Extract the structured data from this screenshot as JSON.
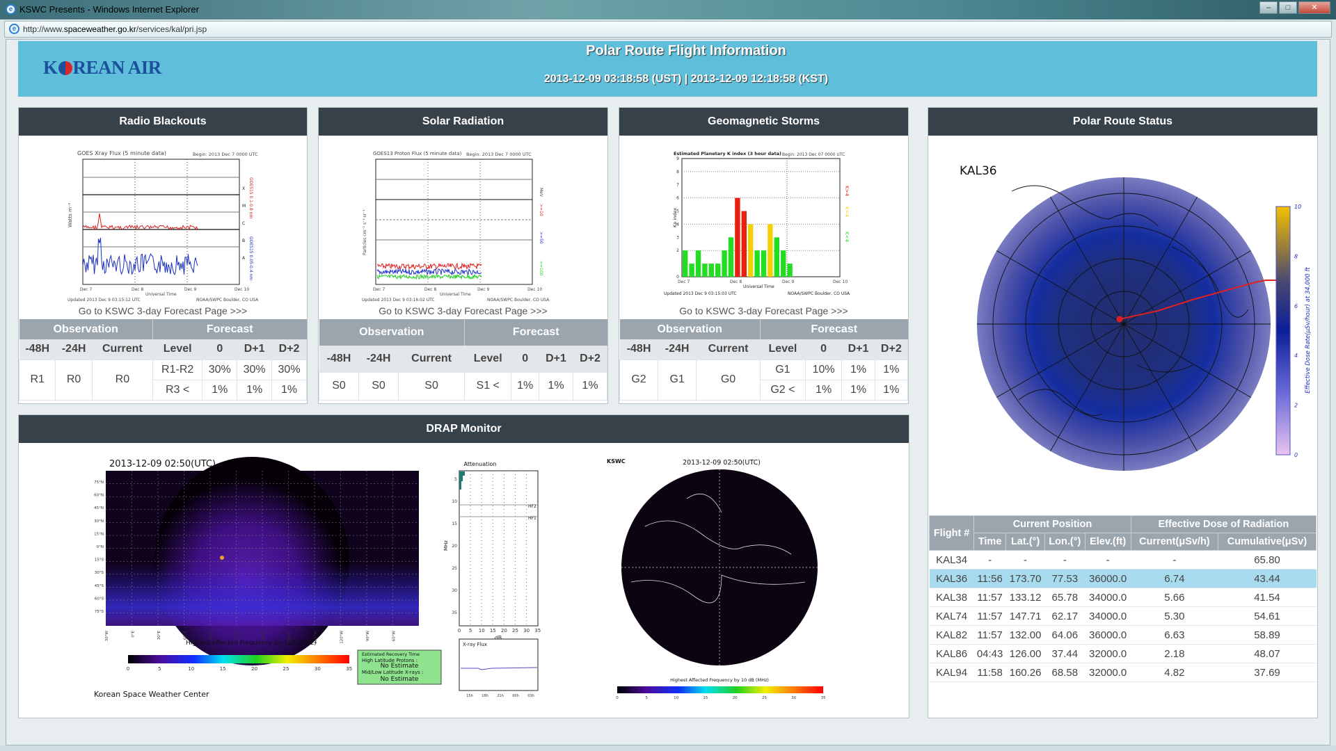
{
  "browser": {
    "title": "KSWC Presents - Windows Internet Explorer",
    "url_prefix": "http://www.",
    "url_domain": "spaceweather.go.kr",
    "url_path": "/services/kal/pri.jsp"
  },
  "header": {
    "logo": "KOREAN AIR",
    "title": "Polar Route Flight Information",
    "time": "2013-12-09 03:18:58 (UST) | 2013-12-09 12:18:58 (KST)"
  },
  "table_headers": {
    "observation": "Observation",
    "forecast": "Forecast",
    "cols": [
      "-48H",
      "-24H",
      "Current",
      "Level",
      "0",
      "D+1",
      "D+2"
    ]
  },
  "radio": {
    "title": "Radio Blackouts",
    "link": "Go to KSWC 3-day Forecast Page >>>",
    "chart": {
      "title": "GOES Xray Flux (5 minute data)",
      "begin": "Begin: 2013 Dec 7 0000 UTC",
      "updated": "Updated 2013 Dec 9 03:15:12 UTC",
      "source": "NOAA/SWPC Boulder, CO USA",
      "xlabel": "Universal Time",
      "ylabel": "Watts m⁻²",
      "x_ticks": [
        "Dec 7",
        "Dec 8",
        "Dec 9",
        "Dec 10"
      ],
      "classes": [
        "X",
        "M",
        "C",
        "B",
        "A"
      ],
      "series": [
        {
          "name": "GOES15 0.1-0.8 nm",
          "color": "#d42020"
        },
        {
          "name": "GOES15 0.05-0.4 nm",
          "color": "#1a2fc0"
        }
      ]
    },
    "obs": [
      "R1",
      "R0",
      "R0"
    ],
    "forecast": [
      {
        "level": "R1-R2",
        "values": [
          "30%",
          "30%",
          "30%"
        ]
      },
      {
        "level": "R3 <",
        "values": [
          "1%",
          "1%",
          "1%"
        ]
      }
    ]
  },
  "solar": {
    "title": "Solar Radiation",
    "link": "Go to KSWC 3-day Forecast Page >>>",
    "chart": {
      "title": "GOES13 Proton Flux (5 minute data)",
      "begin": "Begin: 2013 Dec 7 0000 UTC",
      "updated": "Updated 2013 Dec 9 03:16:02 UTC",
      "source": "NOAA/SWPC Boulder, CO USA",
      "xlabel": "Universal Time",
      "ylabel": "Particles cm⁻² s⁻¹ sr⁻¹",
      "x_ticks": [
        "Dec 7",
        "Dec 8",
        "Dec 9",
        "Dec 10"
      ],
      "unit": "MeV",
      "series": [
        {
          "name": ">=10",
          "color": "#e02020"
        },
        {
          "name": ">=50",
          "color": "#2030d0"
        },
        {
          "name": ">=100",
          "color": "#20d020"
        }
      ]
    },
    "obs": [
      "S0",
      "S0",
      "S0"
    ],
    "forecast": [
      {
        "level": "S1 <",
        "values": [
          "1%",
          "1%",
          "1%"
        ]
      }
    ]
  },
  "geo": {
    "title": "Geomagnetic Storms",
    "link": "Go to KSWC 3-day Forecast Page >>>",
    "chart": {
      "title": "Estimated Planetary K index (3 hour data)",
      "begin": "Begin: 2013 Dec 07 0000 UTC",
      "updated": "Updated 2013 Dec 9 03:15:03 UTC",
      "source": "NOAA/SWPC Boulder, CO USA",
      "xlabel": "Universal Time",
      "ylabel": "Kp index",
      "x_ticks": [
        "Dec 7",
        "Dec 8",
        "Dec 9",
        "Dec 10"
      ],
      "y_ticks": [
        "0",
        "",
        "2",
        "3",
        "4",
        "5",
        "6",
        "7",
        "8",
        "9"
      ],
      "legend": [
        "K>4",
        "K=4",
        "K<4"
      ],
      "kp": [
        2,
        1,
        2,
        1,
        1,
        1,
        2,
        3,
        6,
        5,
        4,
        2,
        2,
        4,
        3,
        2,
        1
      ],
      "colors": {
        "low": "#22dd22",
        "mid": "#f5d000",
        "high": "#e82010"
      }
    },
    "obs": [
      "G2",
      "G1",
      "G0"
    ],
    "forecast": [
      {
        "level": "G1",
        "values": [
          "10%",
          "1%",
          "1%"
        ]
      },
      {
        "level": "G2 <",
        "values": [
          "1%",
          "1%",
          "1%"
        ]
      }
    ]
  },
  "drap": {
    "title": "DRAP Monitor",
    "timestamp": "2013-12-09 02:50(UTC)",
    "lat_ticks": [
      "75°N",
      "60°N",
      "45°N",
      "30°N",
      "15°N",
      "0°N",
      "15°S",
      "30°S",
      "45°S",
      "60°S",
      "75°S"
    ],
    "lon_ticks": [
      "30°W",
      "0°E",
      "30°E",
      "60°E",
      "90°E",
      "120°E",
      "150°E",
      "180°E",
      "150°W",
      "120°W",
      "90°W",
      "60°W"
    ],
    "colorbar_label": "Highest Affected Frequency by 1dB (MHz)",
    "colorbar_ticks": [
      "0",
      "5",
      "10",
      "15",
      "20",
      "25",
      "30",
      "35"
    ],
    "attenuation": {
      "title": "Attenuation",
      "ylabel": "MHz",
      "xlabel": "dB",
      "y_ticks": [
        "5",
        "10",
        "15",
        "20",
        "25",
        "30",
        "35"
      ],
      "x_ticks": [
        "0",
        "5",
        "10",
        "15",
        "20",
        "25",
        "30",
        "35"
      ],
      "hf": [
        "HF2",
        "HF1"
      ]
    },
    "xray": {
      "title": "X-ray Flux",
      "x_ticks": [
        "15h",
        "18h",
        "21h",
        "00h",
        "03h"
      ]
    },
    "recovery": {
      "title": "Estimated Recovery Time",
      "high_label": "High Latitude Protons :",
      "high_value": "No Estimate",
      "low_label": "Mid/Low Latitude X-rays :",
      "low_value": "No Estimate"
    },
    "credit": "Korean Space Weather Center",
    "polar": {
      "label": "KSWC",
      "timestamp": "2013-12-09 02:50(UTC)",
      "colorbar_label": "Highest Affected Frequency by 10 dB (MHz)"
    }
  },
  "polar_route": {
    "title": "Polar Route Status",
    "flight_label": "KAL36",
    "colorbar_label": "Effective Dose Rate(μSv/hour) at 34,000 ft",
    "colorbar_ticks": [
      "0",
      "2",
      "4",
      "6",
      "8",
      "10"
    ],
    "table": {
      "flight_header": "Flight #",
      "group1": "Current Position",
      "group2": "Effective Dose of Radiation",
      "cols": [
        "Time",
        "Lat.(°)",
        "Lon.(°)",
        "Elev.(ft)",
        "Current(μSv/h)",
        "Cumulative(μSv)"
      ],
      "rows": [
        [
          "KAL34",
          "-",
          "-",
          "-",
          "-",
          "-",
          "65.80"
        ],
        [
          "KAL36",
          "11:56",
          "173.70",
          "77.53",
          "36000.0",
          "6.74",
          "43.44"
        ],
        [
          "KAL38",
          "11:57",
          "133.12",
          "65.78",
          "34000.0",
          "5.66",
          "41.54"
        ],
        [
          "KAL74",
          "11:57",
          "147.71",
          "62.17",
          "34000.0",
          "5.30",
          "54.61"
        ],
        [
          "KAL82",
          "11:57",
          "132.00",
          "64.06",
          "36000.0",
          "6.63",
          "58.89"
        ],
        [
          "KAL86",
          "04:43",
          "126.00",
          "37.44",
          "32000.0",
          "2.18",
          "48.07"
        ],
        [
          "KAL94",
          "11:58",
          "160.26",
          "68.58",
          "32000.0",
          "4.82",
          "37.69"
        ]
      ],
      "highlight": "KAL36"
    }
  }
}
